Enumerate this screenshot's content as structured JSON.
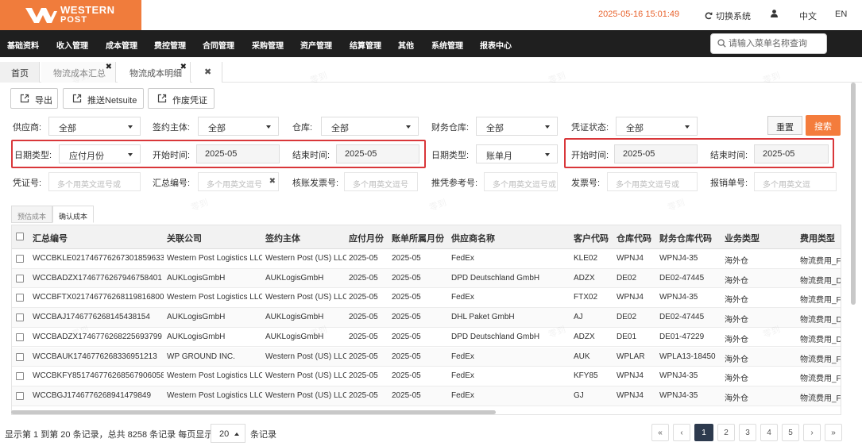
{
  "brand": {
    "line1": "WESTERN",
    "line2": "POST"
  },
  "header": {
    "datetime": "2025-05-16 15:01:49",
    "switch_label": "切换系统",
    "lang_zh": "中文",
    "lang_en": "EN"
  },
  "menu": {
    "items": [
      "基础资料",
      "收入管理",
      "成本管理",
      "费控管理",
      "合同管理",
      "采购管理",
      "资产管理",
      "结算管理",
      "其他",
      "系统管理",
      "报表中心"
    ],
    "search_placeholder": "请输入菜单名称查询"
  },
  "tabs": {
    "home": "首页",
    "tab1": "物流成本汇总",
    "tab2": "物流成本明细",
    "close_all": "✖"
  },
  "toolbar": {
    "export": "导出",
    "push_netsuite": "推送Netsuite",
    "void_voucher": "作废凭证"
  },
  "filters": {
    "supplier_label": "供应商:",
    "supplier_value": "全部",
    "entity_label": "签约主体:",
    "entity_value": "全部",
    "warehouse_label": "仓库:",
    "warehouse_value": "全部",
    "fin_warehouse_label": "财务仓库:",
    "fin_warehouse_value": "全部",
    "voucher_status_label": "凭证状态:",
    "voucher_status_value": "全部",
    "reset": "重置",
    "search": "搜索",
    "date_type_label": "日期类型:",
    "date_type_value": "应付月份",
    "start_label": "开始时间:",
    "start_value": "2025-05",
    "end_label": "结束时间:",
    "end_value": "2025-05",
    "date_type2_label": "日期类型:",
    "date_type2_value": "账单月",
    "start2_label": "开始时间:",
    "start2_value": "2025-05",
    "end2_label": "结束时间:",
    "end2_value": "2025-05",
    "voucher_no_label": "凭证号:",
    "voucher_no_placeholder": "多个用英文逗号或",
    "summary_no_label": "汇总编号:",
    "summary_no_placeholder": "多个用英文逗号",
    "invoice_check_label": "核账发票号:",
    "invoice_check_placeholder": "多个用英文逗号",
    "push_ref_label": "推凭参考号:",
    "push_ref_placeholder": "多个用英文逗号或",
    "invoice_label": "发票号:",
    "invoice_placeholder": "多个用英文逗号或",
    "expense_label": "报销单号:",
    "expense_placeholder": "多个用英文逗"
  },
  "subtabs": {
    "estimated": "预估成本",
    "confirmed": "确认成本"
  },
  "table": {
    "headers": [
      "汇总编号",
      "关联公司",
      "签约主体",
      "应付月份",
      "账单所属月份",
      "供应商名称",
      "客户代码",
      "仓库代码",
      "财务仓库代码",
      "业务类型",
      "费用类型"
    ],
    "rows": [
      [
        "WCCBKLE0217467762673018596​33",
        "Western Post Logistics LLC",
        "Western Post (US) LLC",
        "2025-05",
        "2025-05",
        "FedEx",
        "KLE02",
        "WPNJ4",
        "WPNJ4-35",
        "海外仓",
        "物流费用_Fed"
      ],
      [
        "WCCBADZX1746776267946758401",
        "AUKLogisGmbH",
        "AUKLogisGmbH",
        "2025-05",
        "2025-05",
        "DPD Deutschland GmbH",
        "ADZX",
        "DE02",
        "DE02-47445",
        "海外仓",
        "物流费用_DPD"
      ],
      [
        "WCCBFTX0217467762681198168​00",
        "Western Post Logistics LLC",
        "Western Post (US) LLC",
        "2025-05",
        "2025-05",
        "FedEx",
        "FTX02",
        "WPNJ4",
        "WPNJ4-35",
        "海外仓",
        "物流费用_Fed"
      ],
      [
        "WCCBAJ1746776268145438154",
        "AUKLogisGmbH",
        "AUKLogisGmbH",
        "2025-05",
        "2025-05",
        "DHL Paket GmbH",
        "AJ",
        "DE02",
        "DE02-47445",
        "海外仓",
        "物流费用_DHL"
      ],
      [
        "WCCBADZX1746776268225693799",
        "AUKLogisGmbH",
        "AUKLogisGmbH",
        "2025-05",
        "2025-05",
        "DPD Deutschland GmbH",
        "ADZX",
        "DE01",
        "DE01-47229",
        "海外仓",
        "物流费用_DPD"
      ],
      [
        "WCCBAUK1746776268336951213",
        "WP GROUND INC.",
        "Western Post (US) LLC",
        "2025-05",
        "2025-05",
        "FedEx",
        "AUK",
        "WPLAR",
        "WPLA13-18450",
        "海外仓",
        "物流费用_Fed"
      ],
      [
        "WCCBKFY8517467762685679060​58",
        "Western Post Logistics LLC",
        "Western Post (US) LLC",
        "2025-05",
        "2025-05",
        "FedEx",
        "KFY85",
        "WPNJ4",
        "WPNJ4-35",
        "海外仓",
        "物流费用_Fed"
      ],
      [
        "WCCBGJ1746776268941479849",
        "Western Post Logistics LLC",
        "Western Post (US) LLC",
        "2025-05",
        "2025-05",
        "FedEx",
        "GJ",
        "WPNJ4",
        "WPNJ4-35",
        "海外仓",
        "物流费用_Fed"
      ]
    ]
  },
  "footer": {
    "range_text": "显示第 1 到第 20 条记录，总共 8258 条记录 每页显示",
    "page_size": "20",
    "suffix": "条记录",
    "pages": [
      "«",
      "‹",
      "1",
      "2",
      "3",
      "4",
      "5",
      "›",
      "»"
    ]
  },
  "watermark": "零到",
  "colors": {
    "brand": "#f07c3c",
    "menu_bg": "#1f1f1f",
    "highlight": "#d9373a",
    "active_page": "#2d3a4e"
  }
}
